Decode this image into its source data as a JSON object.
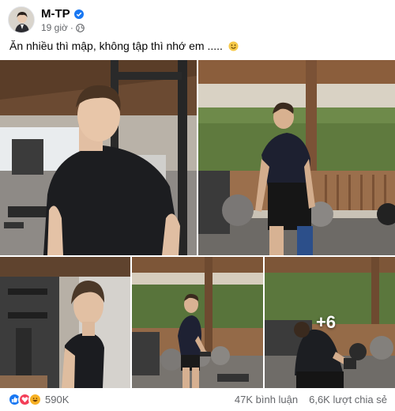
{
  "post": {
    "author": "M-TP",
    "time": "19 giờ",
    "separator": "·",
    "caption": "Ăn nhiều thì mập, không tập thì nhớ em .....",
    "more_photos": "+6"
  },
  "stats": {
    "reactions": "590K",
    "comments": "47K bình luận",
    "shares": "6,6K lượt chia sẻ"
  },
  "icons": [
    "verified-badge-icon",
    "globe-icon",
    "smiley-icon",
    "like-icon",
    "love-icon",
    "haha-icon"
  ],
  "colors": {
    "like": "#1877f2",
    "love": "#f33e58",
    "haha": "#f7b125",
    "verified": "#1877f2"
  }
}
